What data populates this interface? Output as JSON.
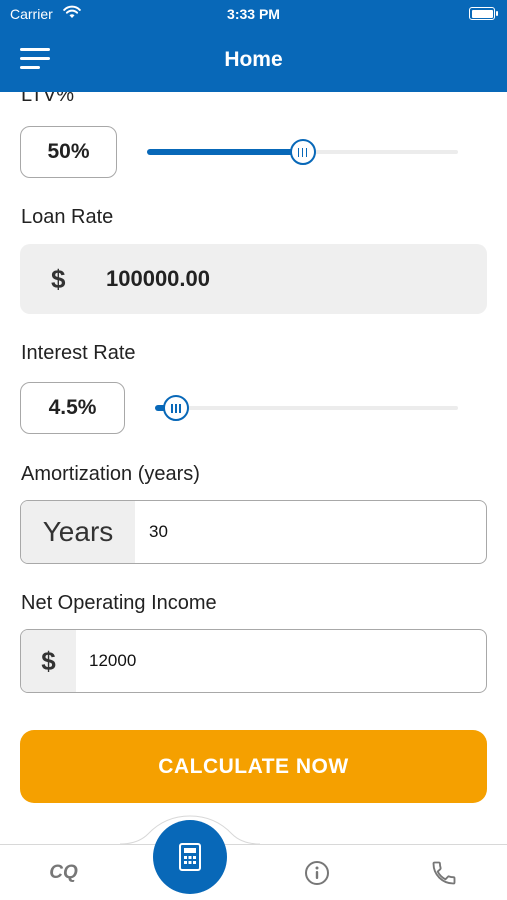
{
  "status_bar": {
    "carrier": "Carrier",
    "time": "3:33 PM",
    "wifi_icon": "wifi-icon",
    "battery_icon": "battery-icon"
  },
  "nav": {
    "title": "Home",
    "menu_icon": "hamburger-menu-icon"
  },
  "form": {
    "ltv": {
      "label": "LTV%",
      "value": "50%",
      "slider_fraction": 0.5
    },
    "loan_rate": {
      "label": "Loan Rate",
      "currency": "$",
      "value": "100000.00"
    },
    "interest_rate": {
      "label": "Interest Rate",
      "value": "4.5%",
      "slider_fraction": 0.07
    },
    "amortization": {
      "label": "Amortization (years)",
      "prefix": "Years",
      "value": "30"
    },
    "noi": {
      "label": "Net Operating Income",
      "prefix": "$",
      "value": "12000"
    },
    "calculate_label": "CALCULATE NOW"
  },
  "tab_bar": {
    "items": [
      {
        "label": "CQ"
      },
      {
        "icon": "calculator-icon"
      },
      {
        "icon": "info-icon"
      },
      {
        "icon": "phone-icon"
      }
    ]
  },
  "colors": {
    "primary": "#0868b8",
    "accent": "#f5a000",
    "input_bg": "#efefef"
  }
}
